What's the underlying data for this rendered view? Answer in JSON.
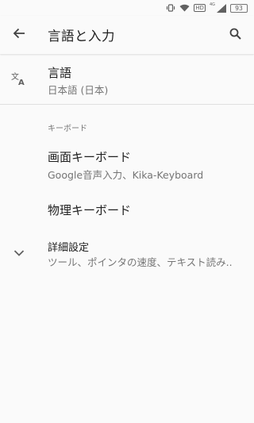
{
  "status_bar": {
    "network_label": "HD",
    "lte_label": "4G",
    "battery": "93"
  },
  "app_bar": {
    "title": "言語と入力"
  },
  "language": {
    "title": "言語",
    "summary": "日本語 (日本)"
  },
  "keyboard_section": {
    "header": "キーボード",
    "virtual_keyboard": {
      "title": "画面キーボード",
      "summary": "Google音声入力、Kika-Keyboard"
    },
    "physical_keyboard": {
      "title": "物理キーボード"
    }
  },
  "advanced": {
    "title": "詳細設定",
    "summary": "ツール、ポインタの速度、テキスト読み.."
  }
}
